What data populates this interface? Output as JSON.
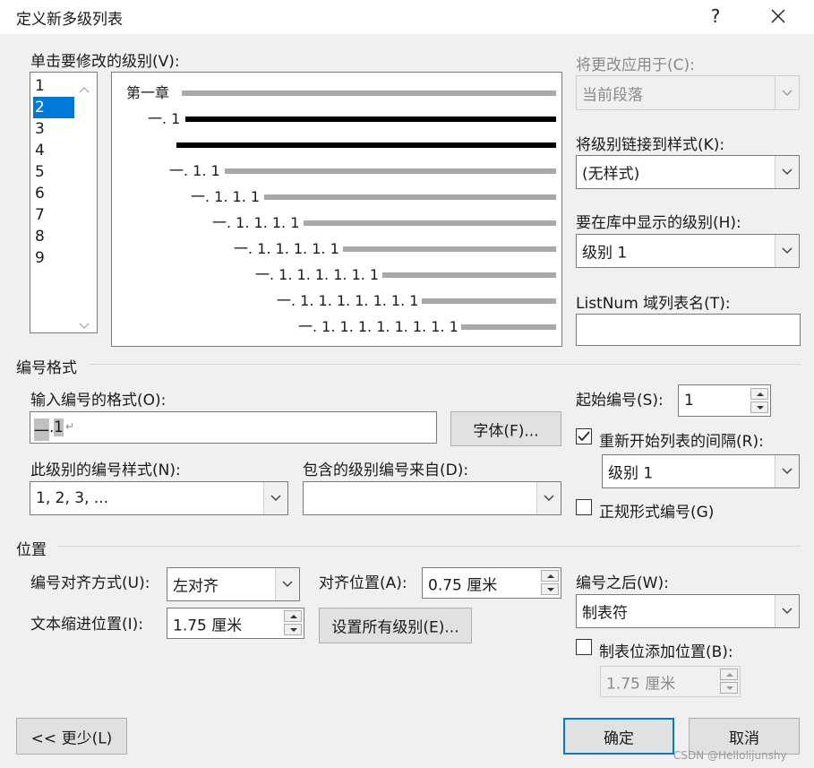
{
  "window": {
    "title": "定义新多级列表",
    "help_label": "?",
    "close_label": "✕"
  },
  "levels": {
    "label": "单击要修改的级别(V):",
    "items": [
      "1",
      "2",
      "3",
      "4",
      "5",
      "6",
      "7",
      "8",
      "9"
    ],
    "selected_index": 1
  },
  "preview": {
    "lines": [
      "第一章",
      "一. 1",
      "一. 1. 1",
      "一. 1. 1. 1",
      "一. 1. 1. 1. 1",
      "一. 1. 1. 1. 1. 1",
      "一. 1. 1. 1. 1. 1. 1",
      "一. 1. 1. 1. 1. 1. 1. 1",
      "一. 1. 1. 1. 1. 1. 1. 1. 1"
    ]
  },
  "right_panel": {
    "apply_to_label": "将更改应用于(C):",
    "apply_to_value": "当前段落",
    "link_style_label": "将级别链接到样式(K):",
    "link_style_value": "(无样式)",
    "gallery_level_label": "要在库中显示的级别(H):",
    "gallery_level_value": "级别 1",
    "listnum_label": "ListNum 域列表名(T):",
    "listnum_value": ""
  },
  "number_format": {
    "section_label": "编号格式",
    "format_label": "输入编号的格式(O):",
    "format_value_prefix": "一",
    "format_value_dot": ".",
    "format_value_num": "1",
    "format_value_mark": "↵",
    "font_button": "字体(F)...",
    "style_label": "此级别的编号样式(N):",
    "style_value": "1, 2, 3, ...",
    "include_label": "包含的级别编号来自(D):",
    "include_value": "",
    "start_label": "起始编号(S):",
    "start_value": "1",
    "restart_label": "重新开始列表的间隔(R):",
    "restart_checked": true,
    "restart_value": "级别 1",
    "legal_label": "正规形式编号(G)",
    "legal_checked": false
  },
  "position": {
    "section_label": "位置",
    "align_label": "编号对齐方式(U):",
    "align_value": "左对齐",
    "align_at_label": "对齐位置(A):",
    "align_at_value": "0.75 厘米",
    "indent_label": "文本缩进位置(I):",
    "indent_value": "1.75 厘米",
    "set_all_button": "设置所有级别(E)...",
    "follow_label": "编号之后(W):",
    "follow_value": "制表符",
    "tab_add_label": "制表位添加位置(B):",
    "tab_add_checked": false,
    "tab_add_value": "1.75 厘米"
  },
  "footer": {
    "less_button": "<< 更少(L)",
    "ok_button": "确定",
    "cancel_button": "取消",
    "watermark": "CSDN @Hellolijunshy"
  }
}
